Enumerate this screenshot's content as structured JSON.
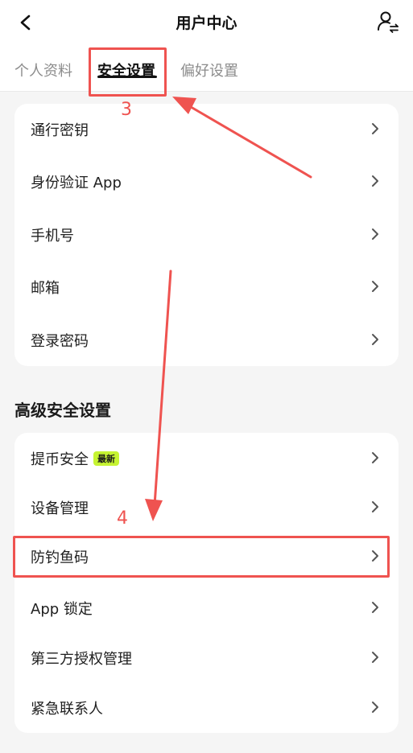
{
  "header": {
    "title": "用户中心"
  },
  "tabs": [
    {
      "label": "个人资料"
    },
    {
      "label": "安全设置"
    },
    {
      "label": "偏好设置"
    }
  ],
  "security_items": [
    {
      "label": "通行密钥"
    },
    {
      "label": "身份验证 App"
    },
    {
      "label": "手机号"
    },
    {
      "label": "邮箱"
    },
    {
      "label": "登录密码"
    }
  ],
  "advanced": {
    "title": "高级安全设置",
    "items": [
      {
        "label": "提币安全",
        "badge": "最新"
      },
      {
        "label": "设备管理"
      },
      {
        "label": "防钓鱼码"
      },
      {
        "label": "App 锁定"
      },
      {
        "label": "第三方授权管理"
      },
      {
        "label": "紧急联系人"
      }
    ]
  },
  "annotations": {
    "step3": "3",
    "step4": "4"
  },
  "colors": {
    "annotation": "#ef5350",
    "badge_bg": "#c6f432"
  }
}
